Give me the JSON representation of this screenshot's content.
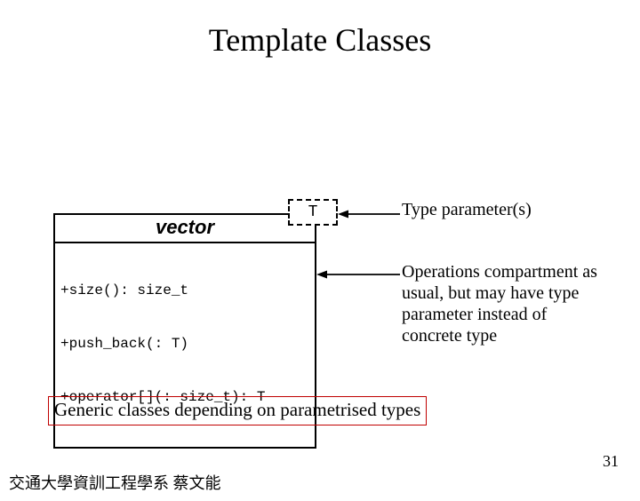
{
  "title": "Template Classes",
  "uml": {
    "class_name": "vector",
    "type_param": "T",
    "operations": [
      "+size(): size_t",
      "+push_back(: T)",
      "+operator[](: size_t): T"
    ]
  },
  "annotations": {
    "type_param_label": "Type parameter(s)",
    "ops_label": "Operations compartment as usual, but may have type parameter instead of concrete type"
  },
  "generic_note": "Generic classes depending on parametrised types",
  "footer": "交通大學資訓工程學系 蔡文能",
  "page_number": "31"
}
